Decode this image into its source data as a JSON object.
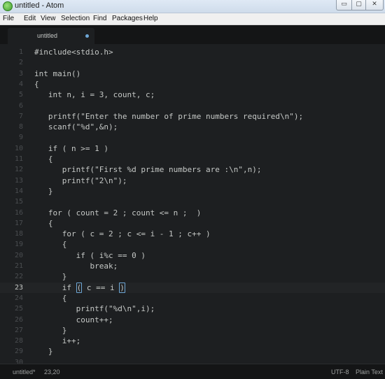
{
  "window": {
    "title": "untitled - Atom",
    "controls": {
      "minimize": "▭",
      "maximize": "▢",
      "close": "✕"
    }
  },
  "menu": [
    "File",
    "Edit",
    "View",
    "Selection",
    "Find",
    "Packages",
    "Help"
  ],
  "tab": {
    "label": "untitled",
    "modified": true
  },
  "editor": {
    "active_line": 23,
    "lines": [
      {
        "n": "1",
        "text": "#include<stdio.h>"
      },
      {
        "n": "2",
        "text": ""
      },
      {
        "n": "3",
        "text": "int main()"
      },
      {
        "n": "4",
        "text": "{"
      },
      {
        "n": "5",
        "text": "   int n, i = 3, count, c;"
      },
      {
        "n": "6",
        "text": ""
      },
      {
        "n": "7",
        "text": "   printf(\"Enter the number of prime numbers required\\n\");"
      },
      {
        "n": "8",
        "text": "   scanf(\"%d\",&n);"
      },
      {
        "n": "9",
        "text": ""
      },
      {
        "n": "10",
        "text": "   if ( n >= 1 )"
      },
      {
        "n": "11",
        "text": "   {"
      },
      {
        "n": "12",
        "text": "      printf(\"First %d prime numbers are :\\n\",n);"
      },
      {
        "n": "13",
        "text": "      printf(\"2\\n\");"
      },
      {
        "n": "14",
        "text": "   }"
      },
      {
        "n": "15",
        "text": ""
      },
      {
        "n": "16",
        "text": "   for ( count = 2 ; count <= n ;  )"
      },
      {
        "n": "17",
        "text": "   {"
      },
      {
        "n": "18",
        "text": "      for ( c = 2 ; c <= i - 1 ; c++ )"
      },
      {
        "n": "19",
        "text": "      {"
      },
      {
        "n": "20",
        "text": "         if ( i%c == 0 )"
      },
      {
        "n": "21",
        "text": "            break;"
      },
      {
        "n": "22",
        "text": "      }"
      },
      {
        "n": "23",
        "text": "      if ( c == i )",
        "brackets": true
      },
      {
        "n": "24",
        "text": "      {"
      },
      {
        "n": "25",
        "text": "         printf(\"%d\\n\",i);"
      },
      {
        "n": "26",
        "text": "         count++;"
      },
      {
        "n": "27",
        "text": "      }"
      },
      {
        "n": "28",
        "text": "      i++;"
      },
      {
        "n": "29",
        "text": "   }"
      },
      {
        "n": "30",
        "text": ""
      }
    ]
  },
  "status": {
    "file": "untitled*",
    "cursor": "23,20",
    "encoding": "UTF-8",
    "grammar": "Plain Text"
  },
  "colors": {
    "editor_bg": "#1d1f21",
    "text": "#c5c8c6",
    "gutter": "#4a4d50",
    "accent": "#6ea7d6"
  }
}
